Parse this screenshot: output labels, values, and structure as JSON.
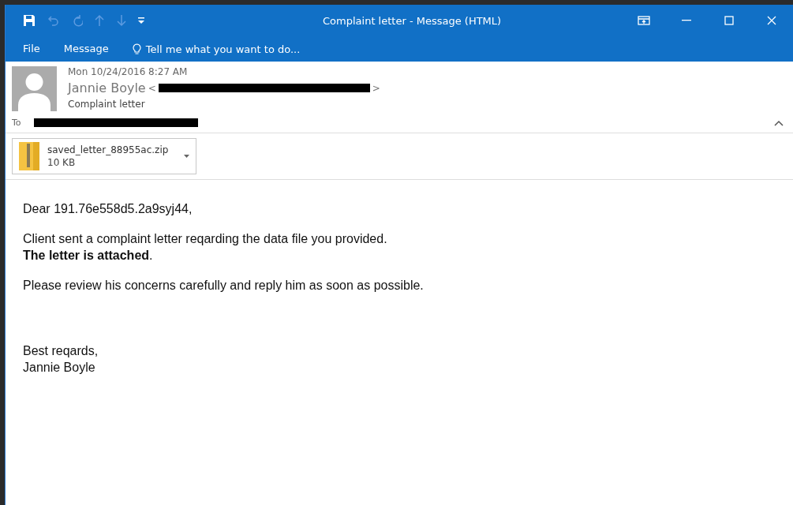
{
  "quick_access": [
    {
      "kind": "save",
      "disabled": false
    },
    {
      "kind": "undo",
      "disabled": true
    },
    {
      "kind": "redo",
      "disabled": true
    },
    {
      "kind": "up",
      "disabled": true
    },
    {
      "kind": "down",
      "disabled": true
    },
    {
      "kind": "customize",
      "disabled": false
    }
  ],
  "window": {
    "title": "Complaint letter - Message (HTML)"
  },
  "window_controls": [
    {
      "kind": "ribbon"
    },
    {
      "kind": "minimize"
    },
    {
      "kind": "maximize"
    },
    {
      "kind": "close"
    }
  ],
  "ribbon_tabs": [
    {
      "label": "File",
      "selected": false
    },
    {
      "label": "Message",
      "selected": false
    }
  ],
  "tell_me": {
    "placeholder": "Tell me what you want to do..."
  },
  "header": {
    "date": "Mon 10/24/2016 8:27 AM",
    "sender": "Jannie Boyle",
    "address_open": "<",
    "address_close": ">",
    "subject": "Complaint letter",
    "to_label": "To"
  },
  "attachments": [
    {
      "name": "saved_letter_88955ac.zip",
      "size": "10 KB"
    }
  ],
  "body": {
    "paragraphs": [
      [
        "Dear 191.76e558d5.2a9syj44,"
      ],
      [
        "Client sent a complaint letter reqarding the data file you provided.",
        "**The letter is attached**."
      ],
      [
        "Please review his concerns carefully and reply him as soon as possible."
      ]
    ],
    "closing": [
      "Best reqards,",
      "Jannie Boyle"
    ]
  }
}
